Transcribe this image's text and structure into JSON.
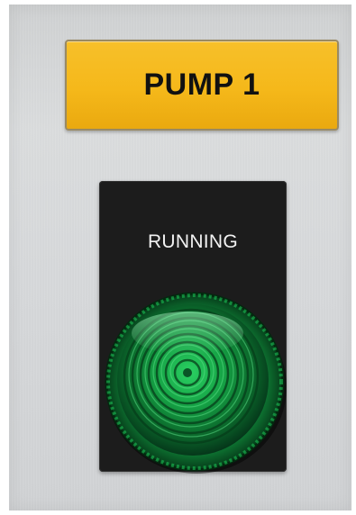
{
  "nameplate": {
    "label": "PUMP 1",
    "color": "#f5b81a"
  },
  "indicator": {
    "legend": "RUNNING",
    "lamp_color": "#1fa84a",
    "lamp_icon": "green-pilot-light",
    "state": "on"
  }
}
